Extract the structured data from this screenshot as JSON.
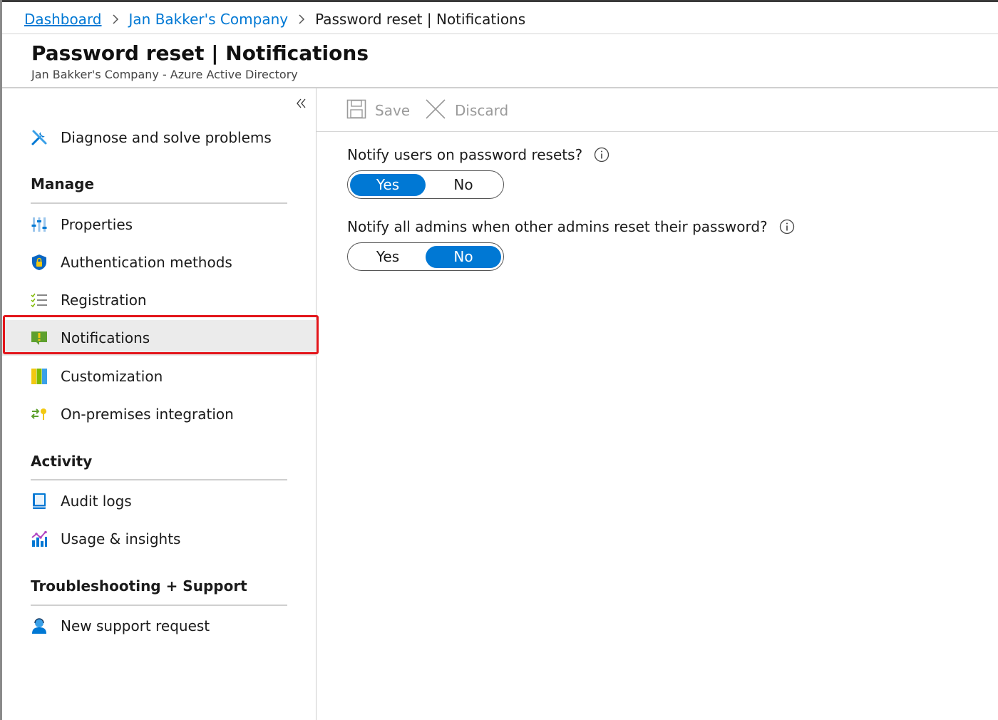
{
  "breadcrumb": {
    "items": [
      "Dashboard",
      "Jan Bakker's Company"
    ],
    "current": "Password reset | Notifications"
  },
  "header": {
    "title": "Password reset | Notifications",
    "subtitle": "Jan Bakker's Company - Azure Active Directory"
  },
  "sidebar": {
    "top_item": {
      "label": "Diagnose and solve problems",
      "icon": "wrench-icon"
    },
    "sections": [
      {
        "title": "Manage",
        "items": [
          {
            "label": "Properties",
            "icon": "properties-icon"
          },
          {
            "label": "Authentication methods",
            "icon": "shield-icon"
          },
          {
            "label": "Registration",
            "icon": "checklist-icon"
          },
          {
            "label": "Notifications",
            "icon": "notification-icon",
            "selected": true
          },
          {
            "label": "Customization",
            "icon": "palette-icon"
          },
          {
            "label": "On-premises integration",
            "icon": "sync-icon"
          }
        ]
      },
      {
        "title": "Activity",
        "items": [
          {
            "label": "Audit logs",
            "icon": "book-icon"
          },
          {
            "label": "Usage & insights",
            "icon": "chart-icon"
          }
        ]
      },
      {
        "title": "Troubleshooting + Support",
        "items": [
          {
            "label": "New support request",
            "icon": "person-icon"
          }
        ]
      }
    ]
  },
  "toolbar": {
    "save_label": "Save",
    "discard_label": "Discard"
  },
  "settings": [
    {
      "question": "Notify users on password resets?",
      "options": [
        "Yes",
        "No"
      ],
      "selected": "Yes"
    },
    {
      "question": "Notify all admins when other admins reset their password?",
      "options": [
        "Yes",
        "No"
      ],
      "selected": "No"
    }
  ],
  "colors": {
    "accent": "#0078d4",
    "highlight": "#e3151a",
    "selected_bg": "#ebebeb"
  }
}
